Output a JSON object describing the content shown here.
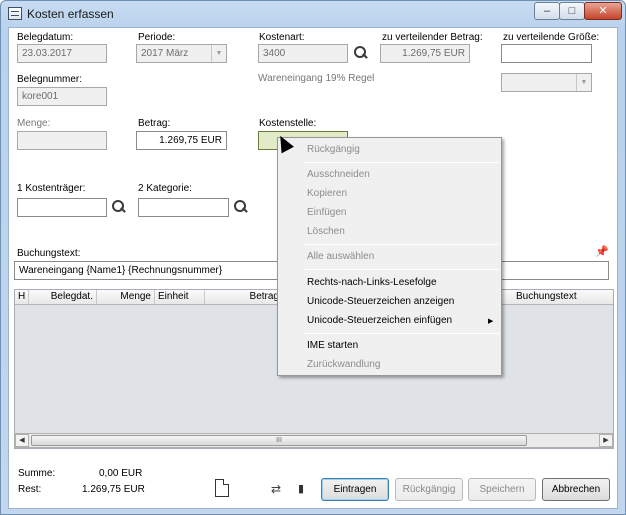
{
  "window": {
    "title": "Kosten erfassen",
    "min": "–",
    "max": "□",
    "close": "✕"
  },
  "form": {
    "belegdatum_label": "Belegdatum:",
    "belegdatum_value": "23.03.2017",
    "periode_label": "Periode:",
    "periode_value": "2017  März",
    "kostenart_label": "Kostenart:",
    "kostenart_value": "3400",
    "betrag_verteilen_label": "zu verteilender Betrag:",
    "betrag_verteilen_value": "1.269,75 EUR",
    "groesse_label": "zu verteilende Größe:",
    "groesse_value": "",
    "belegnummer_label": "Belegnummer:",
    "belegnummer_value": "kore001",
    "kostenart_desc": "Wareneingang 19% Regel",
    "menge_label": "Menge:",
    "menge_value": "",
    "betrag_label": "Betrag:",
    "betrag_value": "1.269,75 EUR",
    "kostenstelle_label": "Kostenstelle:",
    "kostenstelle_value": "",
    "kostentraeger_label": "1 Kostenträger:",
    "kategorie_label": "2 Kategorie:",
    "buchungstext_label": "Buchungstext:",
    "buchungstext_value": "Wareneingang {Name1} {Rechnungsnummer}"
  },
  "grid": {
    "columns": [
      "H",
      "Belegdat.",
      "Menge",
      "Einheit",
      "Betrag",
      "Buchungstext"
    ]
  },
  "summary": {
    "summe_label": "Summe:",
    "summe_value": "0,00 EUR",
    "rest_label": "Rest:",
    "rest_value": "1.269,75 EUR"
  },
  "buttons": {
    "eintragen": "Eintragen",
    "rueckgaengig": "Rückgängig",
    "speichern": "Speichern",
    "abbrechen": "Abbrechen"
  },
  "context_menu": {
    "items": [
      {
        "label": "Rückgängig",
        "enabled": false
      },
      {
        "label": "Ausschneiden",
        "enabled": false
      },
      {
        "label": "Kopieren",
        "enabled": false
      },
      {
        "label": "Einfügen",
        "enabled": false
      },
      {
        "label": "Löschen",
        "enabled": false
      },
      {
        "label": "Alle auswählen",
        "enabled": false
      },
      {
        "label": "Rechts-nach-Links-Lesefolge",
        "enabled": true
      },
      {
        "label": "Unicode-Steuerzeichen anzeigen",
        "enabled": true
      },
      {
        "label": "Unicode-Steuerzeichen einfügen",
        "enabled": true,
        "submenu": true
      },
      {
        "label": "IME starten",
        "enabled": true
      },
      {
        "label": "Zurückwandlung",
        "enabled": false
      }
    ]
  },
  "scrollbar": {
    "grip": "III",
    "left": "◀",
    "right": "▶"
  }
}
